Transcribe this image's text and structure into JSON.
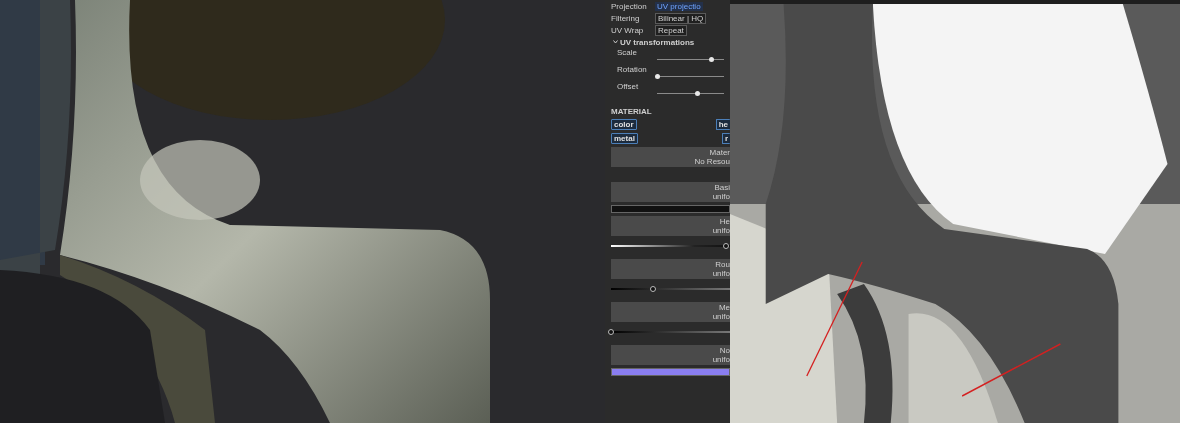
{
  "properties": [
    {
      "label": "Projection",
      "value": "UV projectio",
      "kind": "link"
    },
    {
      "label": "Filtering",
      "value": "Bilinear | HQ",
      "kind": "box"
    },
    {
      "label": "UV Wrap",
      "value": "Repeat",
      "kind": "box"
    }
  ],
  "uv_transformations": {
    "title": "UV transformations",
    "expanded": true,
    "sliders": [
      {
        "label": "Scale",
        "level": 0.8
      },
      {
        "label": "Rotation",
        "level": 0.0
      },
      {
        "label": "Offset",
        "level": 0.6
      }
    ]
  },
  "material": {
    "title": "MATERIAL",
    "channels": [
      "color",
      "he",
      "metal",
      "r"
    ],
    "slot": {
      "title": "Mater",
      "subtitle": "No Resou"
    },
    "maps": [
      {
        "title": "Basi",
        "subtitle": "unifo",
        "kind": "swatch",
        "color": "#111111"
      },
      {
        "title": "He",
        "subtitle": "unifo",
        "kind": "gradient",
        "level": 0.97
      },
      {
        "title": "Rou",
        "subtitle": "unifo",
        "kind": "slider",
        "level": 0.35
      },
      {
        "title": "Me",
        "subtitle": "unifo",
        "kind": "slider",
        "level": 0.0
      },
      {
        "title": "No",
        "subtitle": "unifo",
        "kind": "swatch",
        "color": "#8a7ef0"
      }
    ]
  }
}
